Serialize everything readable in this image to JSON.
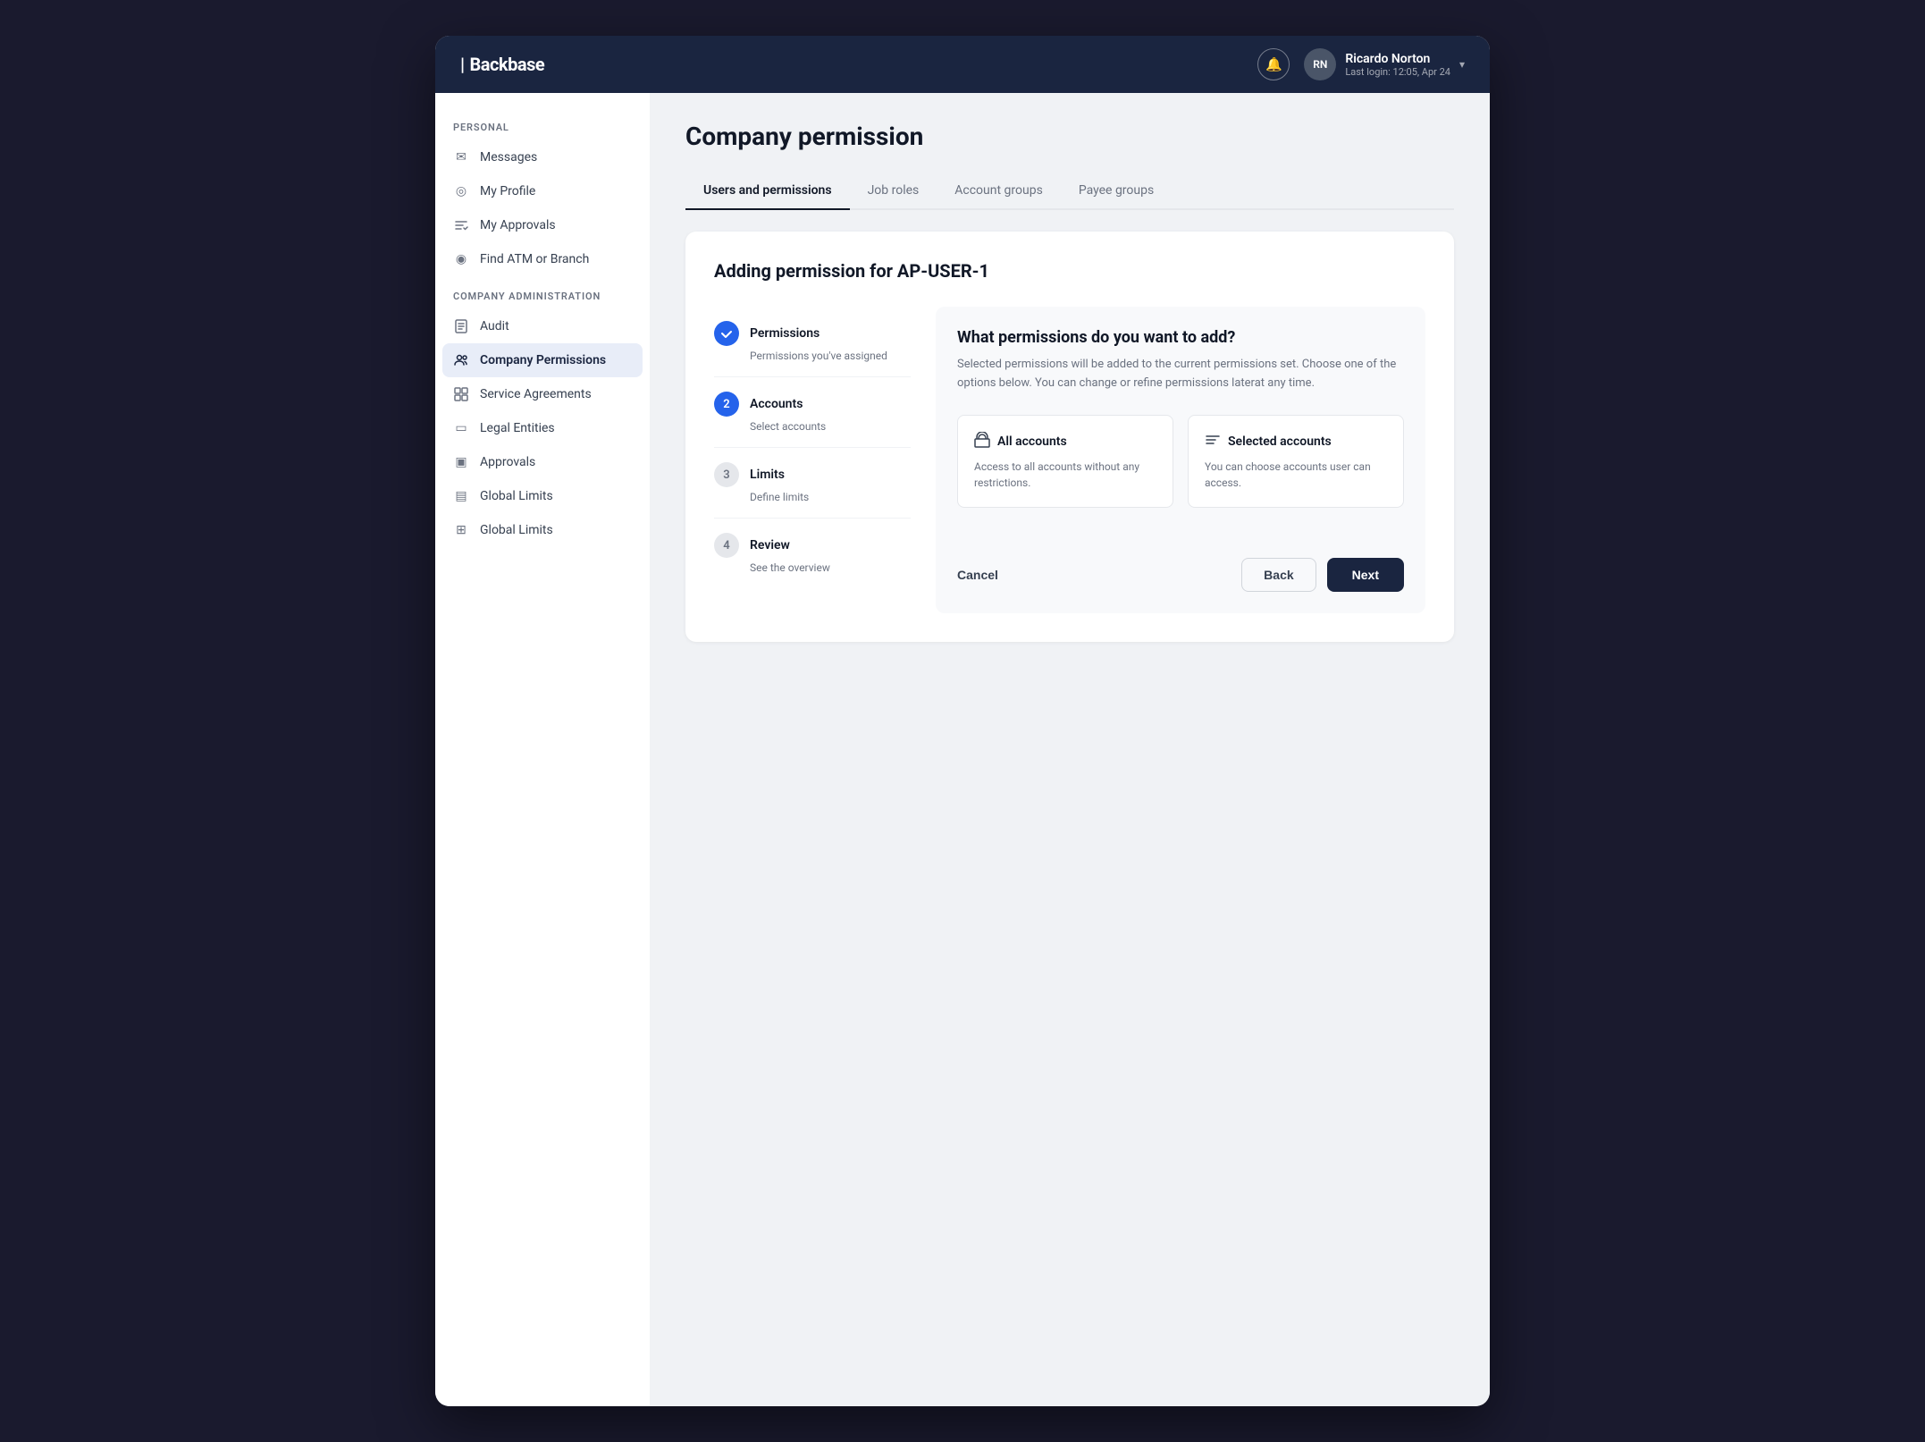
{
  "header": {
    "logo": "Backbase",
    "bell_label": "🔔",
    "user": {
      "initials": "RN",
      "name": "Ricardo Norton",
      "last_login": "Last login: 12:05, Apr 24"
    }
  },
  "sidebar": {
    "personal_label": "PERSONAL",
    "personal_items": [
      {
        "id": "messages",
        "icon": "✉",
        "label": "Messages"
      },
      {
        "id": "my-profile",
        "icon": "◎",
        "label": "My Profile"
      },
      {
        "id": "my-approvals",
        "icon": "✗",
        "label": "My Approvals"
      },
      {
        "id": "find-atm",
        "icon": "◉",
        "label": "Find ATM or Branch"
      }
    ],
    "company_label": "COMPANY ADMINISTRATION",
    "company_items": [
      {
        "id": "audit",
        "icon": "▤",
        "label": "Audit"
      },
      {
        "id": "company-permissions",
        "icon": "👥",
        "label": "Company Permissions",
        "active": true
      },
      {
        "id": "service-agreements",
        "icon": "▦",
        "label": "Service Agreements"
      },
      {
        "id": "legal-entities",
        "icon": "▭",
        "label": "Legal Entities"
      },
      {
        "id": "approvals",
        "icon": "▣",
        "label": "Approvals"
      },
      {
        "id": "global-limits-1",
        "icon": "▤",
        "label": "Global Limits"
      },
      {
        "id": "global-limits-2",
        "icon": "⊞",
        "label": "Global Limits"
      }
    ]
  },
  "page": {
    "title": "Company permission",
    "tabs": [
      {
        "id": "users-permissions",
        "label": "Users and permissions",
        "active": true
      },
      {
        "id": "job-roles",
        "label": "Job roles",
        "active": false
      },
      {
        "id": "account-groups",
        "label": "Account groups",
        "active": false
      },
      {
        "id": "payee-groups",
        "label": "Payee groups",
        "active": false
      }
    ]
  },
  "wizard": {
    "card_title": "Adding permission for AP-USER-1",
    "steps": [
      {
        "id": "permissions",
        "number": "✓",
        "state": "completed",
        "label": "Permissions",
        "sublabel": "Permissions you've assigned"
      },
      {
        "id": "accounts",
        "number": "2",
        "state": "active",
        "label": "Accounts",
        "sublabel": "Select accounts"
      },
      {
        "id": "limits",
        "number": "3",
        "state": "inactive",
        "label": "Limits",
        "sublabel": "Define limits"
      },
      {
        "id": "review",
        "number": "4",
        "state": "inactive",
        "label": "Review",
        "sublabel": "See the overview"
      }
    ],
    "content": {
      "question": "What permissions do you want to add?",
      "description": "Selected permissions will be added to the current permissions set. Choose one of the options below. You can change or refine permissions laterat any time.",
      "options": [
        {
          "id": "all-accounts",
          "icon": "🏛",
          "title": "All accounts",
          "description": "Access to all accounts without any restrictions."
        },
        {
          "id": "selected-accounts",
          "icon": "≡",
          "title": "Selected accounts",
          "description": "You can choose accounts user can access."
        }
      ]
    },
    "footer": {
      "cancel_label": "Cancel",
      "back_label": "Back",
      "next_label": "Next"
    }
  }
}
